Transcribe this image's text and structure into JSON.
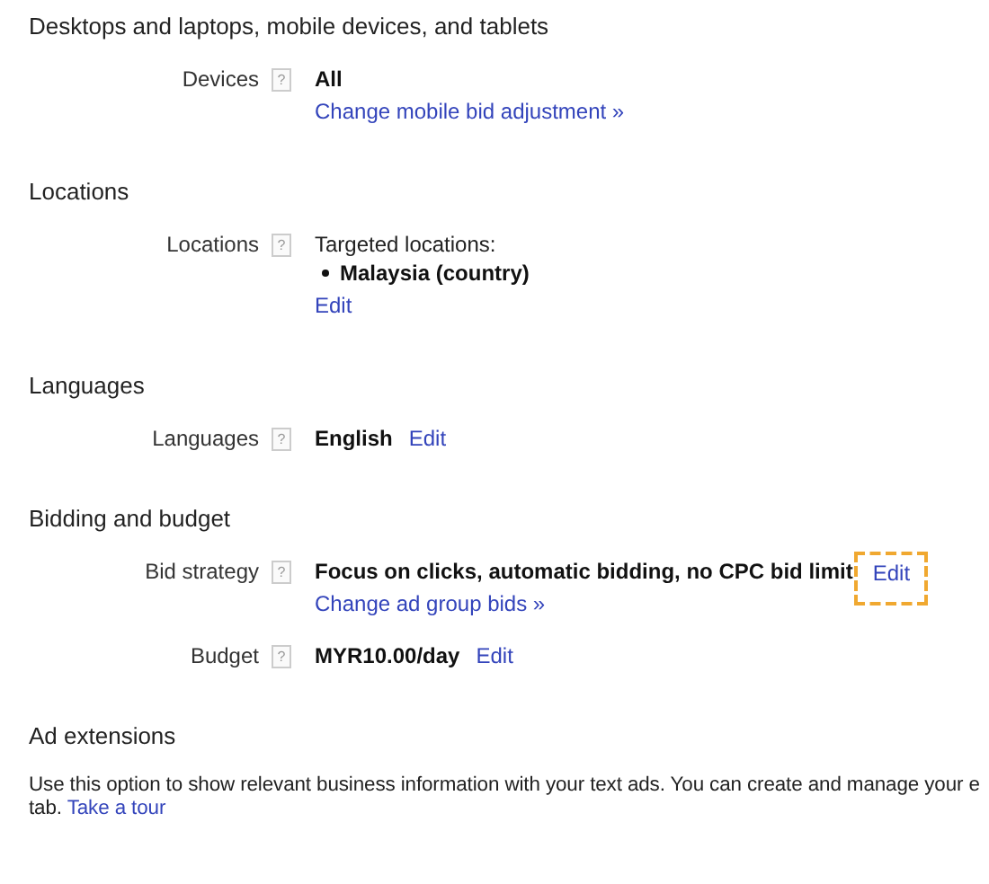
{
  "sections": [
    {
      "title": "Desktops and laptops, mobile devices, and tablets",
      "rows": [
        {
          "label": "Devices",
          "help": "?",
          "value": "All",
          "below_links": [
            {
              "text": "Change mobile bid adjustment »",
              "highlighted": false
            }
          ]
        }
      ]
    },
    {
      "title": "Locations",
      "rows": [
        {
          "label": "Locations",
          "help": "?",
          "lead": "Targeted locations:",
          "bullets": [
            "Malaysia (country)"
          ],
          "below_links": [
            {
              "text": "Edit",
              "highlighted": false
            }
          ]
        }
      ]
    },
    {
      "title": "Languages",
      "rows": [
        {
          "label": "Languages",
          "help": "?",
          "value": "English",
          "inline_links": [
            {
              "text": "Edit",
              "highlighted": false
            }
          ]
        }
      ]
    },
    {
      "title": "Bidding and budget",
      "rows": [
        {
          "label": "Bid strategy",
          "help": "?",
          "value": "Focus on clicks, automatic bidding, no CPC bid limit",
          "inline_links": [
            {
              "text": "Edit",
              "highlighted": true
            }
          ],
          "below_links": [
            {
              "text": "Change ad group bids »",
              "highlighted": false
            }
          ]
        },
        {
          "label": "Budget",
          "help": "?",
          "value": "MYR10.00/day",
          "inline_links": [
            {
              "text": "Edit",
              "highlighted": false
            }
          ]
        }
      ]
    },
    {
      "title": "Ad extensions",
      "paragraph": {
        "lines": [
          "Use this option to show relevant business information with your text ads. You can create and manage your e",
          "tab."
        ],
        "link": "Take a tour"
      }
    }
  ]
}
